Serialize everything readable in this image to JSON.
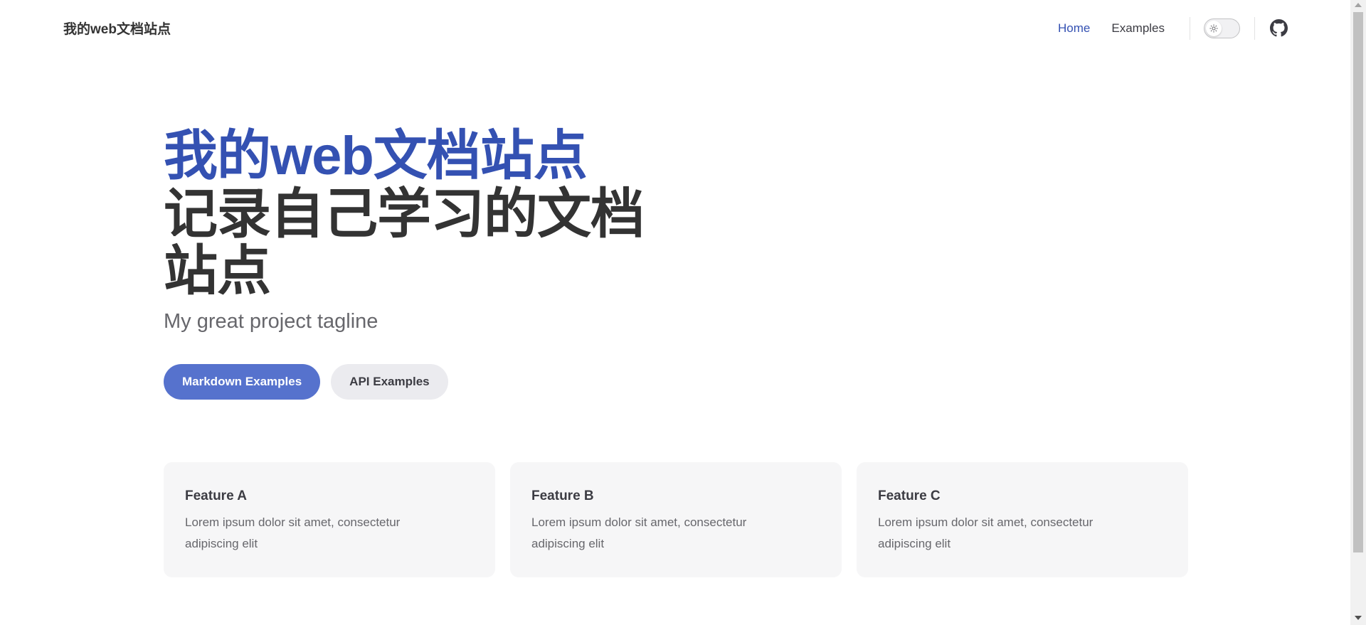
{
  "navbar": {
    "site_title": "我的web文档站点",
    "links": [
      {
        "label": "Home",
        "active": true
      },
      {
        "label": "Examples",
        "active": false
      }
    ],
    "theme_toggle_icon": "sun-icon",
    "social_icon": "github-icon"
  },
  "hero": {
    "name": "我的web文档站点",
    "text": "记录自己学习的文档站点",
    "tagline": "My great project tagline",
    "actions": [
      {
        "label": "Markdown Examples",
        "theme": "brand"
      },
      {
        "label": "API Examples",
        "theme": "alt"
      }
    ]
  },
  "features": [
    {
      "title": "Feature A",
      "details": "Lorem ipsum dolor sit amet, consectetur adipiscing elit"
    },
    {
      "title": "Feature B",
      "details": "Lorem ipsum dolor sit amet, consectetur adipiscing elit"
    },
    {
      "title": "Feature C",
      "details": "Lorem ipsum dolor sit amet, consectetur adipiscing elit"
    }
  ],
  "colors": {
    "brand": "#3451b2",
    "button_brand_bg": "#5672cd",
    "button_alt_bg": "#ebebef",
    "feature_bg": "#f6f6f7"
  }
}
